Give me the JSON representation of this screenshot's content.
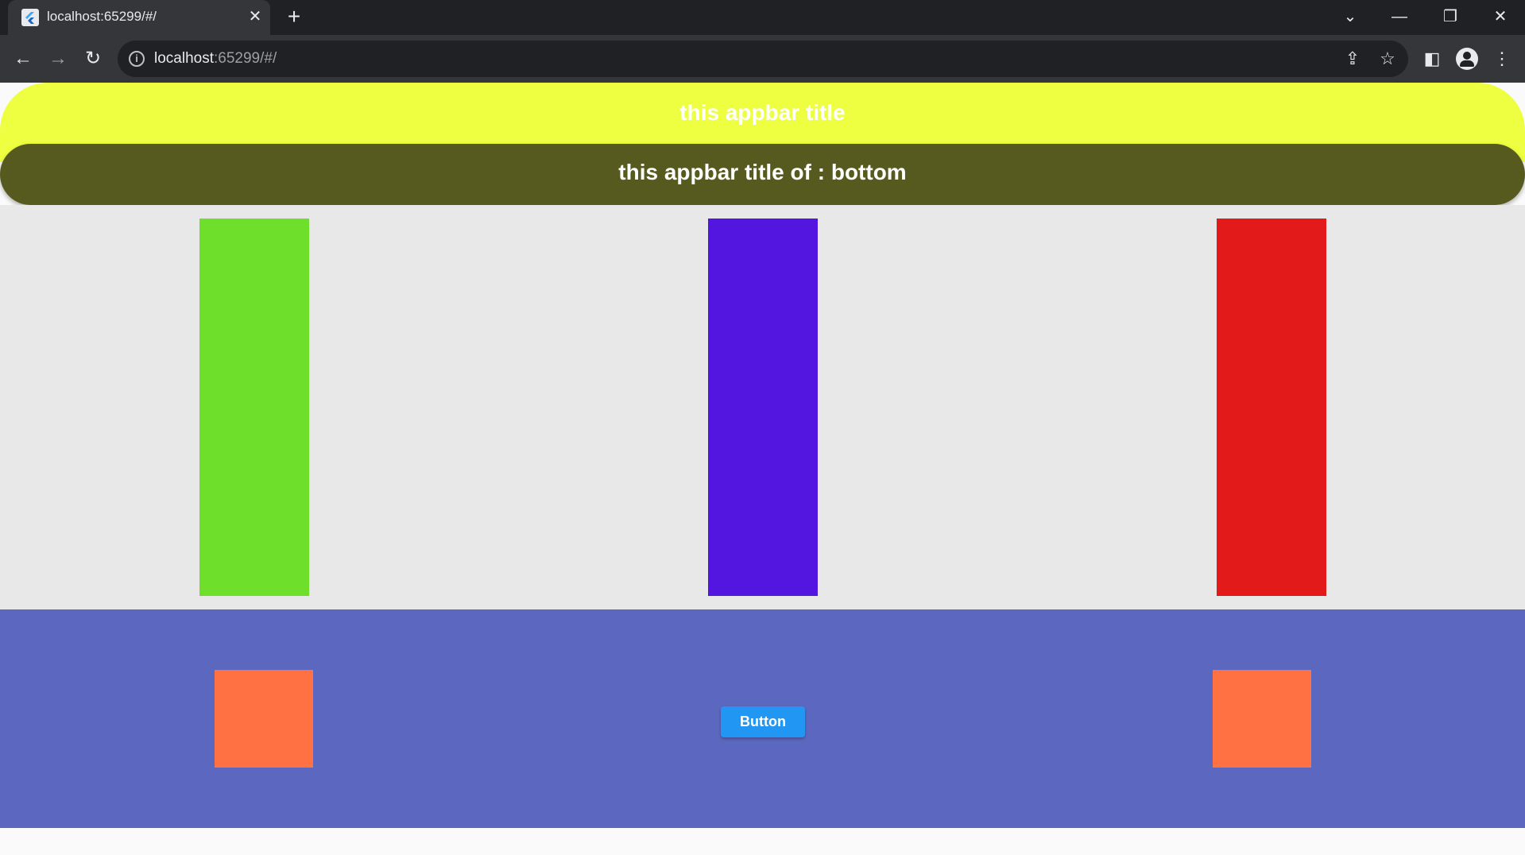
{
  "browser": {
    "tab_title": "localhost:65299/#/",
    "url_host": "localhost",
    "url_rest": ":65299/#/"
  },
  "app": {
    "appbar_title": "this appbar title",
    "appbar_bottom_title": "this appbar title of : bottom",
    "button_label": "Button"
  },
  "colors": {
    "appbar": "#eeff41",
    "appbar_bottom": "#575a1e",
    "body": "#e8e8e8",
    "bar_green": "#6ee02c",
    "bar_purple": "#5315e0",
    "bar_red": "#e21a1a",
    "bottom_section": "#5c67bf",
    "square": "#ff7043",
    "button": "#2196f3"
  }
}
